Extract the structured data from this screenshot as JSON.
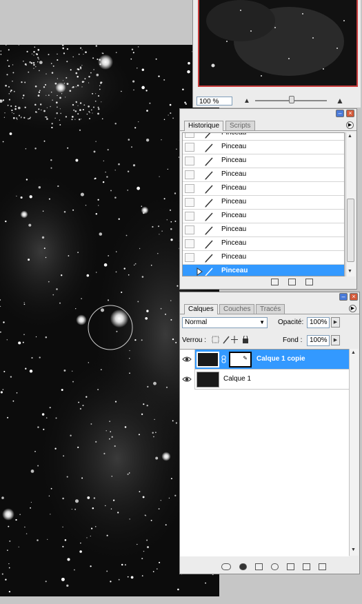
{
  "navigator": {
    "zoom": "100 %"
  },
  "history": {
    "tabs": [
      "Historique",
      "Scripts"
    ],
    "items": [
      "Pinceau",
      "Pinceau",
      "Pinceau",
      "Pinceau",
      "Pinceau",
      "Pinceau",
      "Pinceau",
      "Pinceau",
      "Pinceau",
      "Pinceau",
      "Pinceau"
    ],
    "selected_index": 10
  },
  "layers": {
    "tabs": [
      "Calques",
      "Couches",
      "Tracés"
    ],
    "blend_mode": "Normal",
    "opacity_label": "Opacité:",
    "opacity_value": "100%",
    "lock_label": "Verrou :",
    "fill_label": "Fond :",
    "fill_value": "100%",
    "rows": [
      {
        "name": "Calque 1 copie",
        "selected": true,
        "has_mask": true
      },
      {
        "name": "Calque 1",
        "selected": false,
        "has_mask": false
      }
    ]
  },
  "colors": {
    "selection": "#3399ff",
    "nav_frame": "#c83b3b"
  },
  "icons": [
    "eye-icon",
    "brush-icon",
    "chain-icon",
    "lock-icon",
    "move-icon",
    "dropdown-arrow-icon",
    "palette-menu-icon",
    "trash-icon",
    "new-layer-icon",
    "folder-icon"
  ]
}
